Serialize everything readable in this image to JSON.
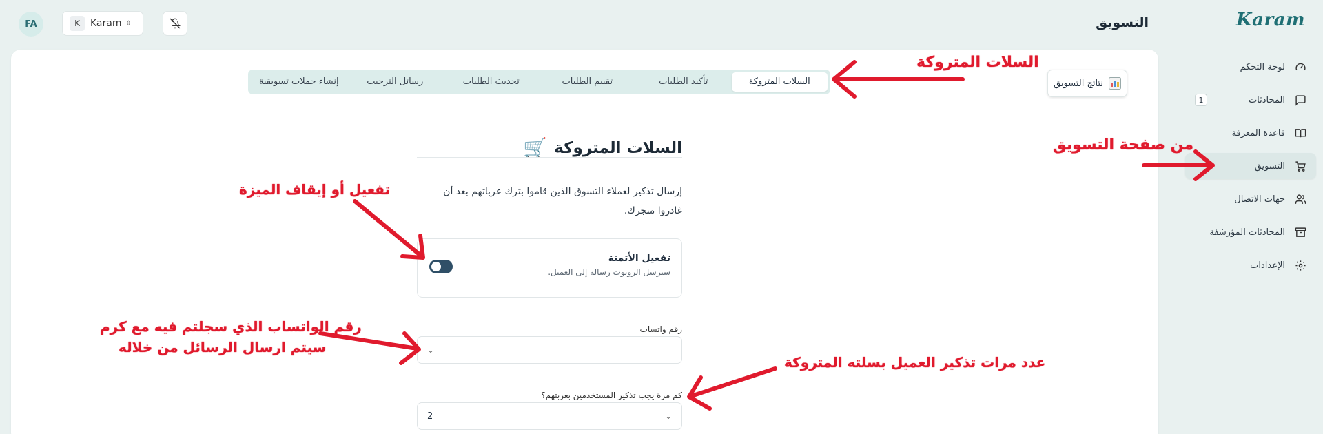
{
  "header": {
    "avatar_initials": "FA",
    "account_initial": "K",
    "account_name": "Karam",
    "page_title": "التسويق",
    "logo_text": "Karam"
  },
  "sidebar": {
    "items": [
      {
        "label": "لوحة التحكم",
        "icon": "gauge-icon"
      },
      {
        "label": "المحادثات",
        "icon": "message-icon",
        "badge": "1"
      },
      {
        "label": "قاعدة المعرفة",
        "icon": "book-icon"
      },
      {
        "label": "التسويق",
        "icon": "cart-icon",
        "active": true
      },
      {
        "label": "جهات الاتصال",
        "icon": "users-icon"
      },
      {
        "label": "المحادثات المؤرشفة",
        "icon": "archive-icon"
      },
      {
        "label": "الإعدادات",
        "icon": "gear-icon"
      }
    ]
  },
  "main": {
    "results_button": "نتائج التسويق",
    "tabs": [
      {
        "label": "السلات المتروكة",
        "active": true
      },
      {
        "label": "تأكيد الطلبات"
      },
      {
        "label": "تقييم الطلبات"
      },
      {
        "label": "تحديث الطلبات"
      },
      {
        "label": "رسائل الترحيب"
      },
      {
        "label": "إنشاء حملات تسويقية"
      }
    ],
    "section_title": "السلات المتروكة",
    "description": "إرسال تذكير لعملاء التسوق الذين قاموا بترك عرباتهم بعد أن غادروا متجرك.",
    "automation": {
      "title": "تفعيل الأتمتة",
      "subtitle": "سيرسل الروبوت رسالة إلى العميل.",
      "enabled": false
    },
    "whatsapp": {
      "label": "رقم واتساب",
      "value": ""
    },
    "reminders": {
      "label": "كم مرة يجب تذكير المستخدمين بعربتهم؟",
      "value": "2"
    }
  },
  "annotations": {
    "abandoned_carts": "السلات المتروكة",
    "from_marketing_page": "من صفحة التسويق",
    "toggle_feature": "تفعيل أو إيقاف الميزة",
    "whatsapp_line1": "رقم الواتساب الذي سجلتم فيه مع كرم",
    "whatsapp_line2": "سيتم ارسال الرسائل من خلاله",
    "reminder_count": "عدد مرات تذكير العميل بسلته المتروكة"
  },
  "colors": {
    "accent": "#1f6f74",
    "tabs_bg": "#dcedeb",
    "annotation_red": "#e01a2d",
    "toggle": "#2f4f67"
  }
}
